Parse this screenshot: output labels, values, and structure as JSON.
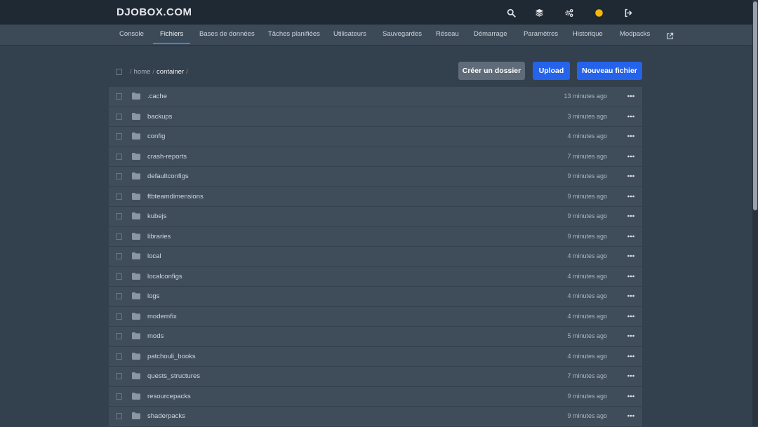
{
  "app": {
    "brand": "DJOBOX.COM"
  },
  "topbar": {
    "icons": [
      {
        "name": "search-icon"
      },
      {
        "name": "layers-icon"
      },
      {
        "name": "cogs-icon"
      },
      {
        "name": "status-dot-icon",
        "color": "#f5b90a"
      },
      {
        "name": "sign-out-icon"
      }
    ]
  },
  "nav": {
    "tabs": [
      {
        "label": "Console"
      },
      {
        "label": "Fichiers",
        "active": true
      },
      {
        "label": "Bases de données"
      },
      {
        "label": "Tâches planifiées"
      },
      {
        "label": "Utilisateurs"
      },
      {
        "label": "Sauvegardes"
      },
      {
        "label": "Réseau"
      },
      {
        "label": "Démarrage"
      },
      {
        "label": "Paramètres"
      },
      {
        "label": "Historique"
      },
      {
        "label": "Modpacks"
      }
    ],
    "external_link_icon": "external-link-icon"
  },
  "breadcrumb": {
    "separator": "/",
    "items": [
      "home",
      "container"
    ]
  },
  "actions": {
    "create_folder": "Créer un dossier",
    "upload": "Upload",
    "new_file": "Nouveau fichier"
  },
  "files": [
    {
      "name": ".cache",
      "modified": "13 minutes ago"
    },
    {
      "name": "backups",
      "modified": "3 minutes ago"
    },
    {
      "name": "config",
      "modified": "4 minutes ago"
    },
    {
      "name": "crash-reports",
      "modified": "7 minutes ago"
    },
    {
      "name": "defaultconfigs",
      "modified": "9 minutes ago"
    },
    {
      "name": "ftbteamdimensions",
      "modified": "9 minutes ago"
    },
    {
      "name": "kubejs",
      "modified": "9 minutes ago"
    },
    {
      "name": "libraries",
      "modified": "9 minutes ago"
    },
    {
      "name": "local",
      "modified": "4 minutes ago"
    },
    {
      "name": "localconfigs",
      "modified": "4 minutes ago"
    },
    {
      "name": "logs",
      "modified": "4 minutes ago"
    },
    {
      "name": "modernfix",
      "modified": "4 minutes ago"
    },
    {
      "name": "mods",
      "modified": "5 minutes ago"
    },
    {
      "name": "patchouli_books",
      "modified": "4 minutes ago"
    },
    {
      "name": "quests_structures",
      "modified": "7 minutes ago"
    },
    {
      "name": "resourcepacks",
      "modified": "9 minutes ago"
    },
    {
      "name": "shaderpacks",
      "modified": "9 minutes ago"
    }
  ],
  "colors": {
    "accent": "#2563eb",
    "tab_indicator": "#3b82f6",
    "status": "#f5b90a"
  }
}
